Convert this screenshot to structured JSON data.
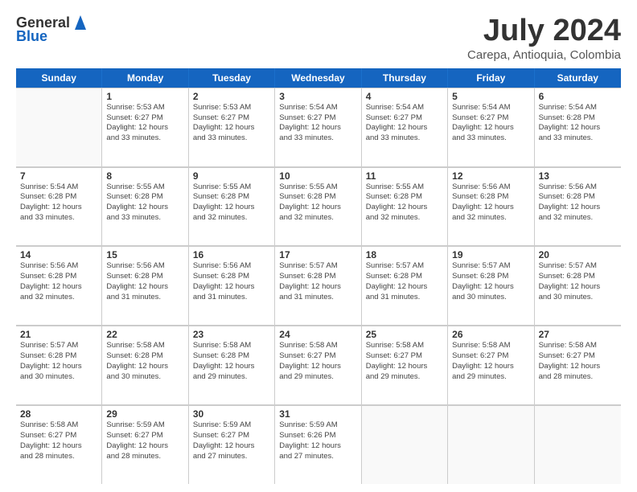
{
  "logo": {
    "text1": "General",
    "text2": "Blue"
  },
  "header": {
    "month": "July 2024",
    "location": "Carepa, Antioquia, Colombia"
  },
  "weekdays": [
    "Sunday",
    "Monday",
    "Tuesday",
    "Wednesday",
    "Thursday",
    "Friday",
    "Saturday"
  ],
  "rows": [
    [
      {
        "day": "",
        "info": ""
      },
      {
        "day": "1",
        "info": "Sunrise: 5:53 AM\nSunset: 6:27 PM\nDaylight: 12 hours\nand 33 minutes."
      },
      {
        "day": "2",
        "info": "Sunrise: 5:53 AM\nSunset: 6:27 PM\nDaylight: 12 hours\nand 33 minutes."
      },
      {
        "day": "3",
        "info": "Sunrise: 5:54 AM\nSunset: 6:27 PM\nDaylight: 12 hours\nand 33 minutes."
      },
      {
        "day": "4",
        "info": "Sunrise: 5:54 AM\nSunset: 6:27 PM\nDaylight: 12 hours\nand 33 minutes."
      },
      {
        "day": "5",
        "info": "Sunrise: 5:54 AM\nSunset: 6:27 PM\nDaylight: 12 hours\nand 33 minutes."
      },
      {
        "day": "6",
        "info": "Sunrise: 5:54 AM\nSunset: 6:28 PM\nDaylight: 12 hours\nand 33 minutes."
      }
    ],
    [
      {
        "day": "7",
        "info": "Sunrise: 5:54 AM\nSunset: 6:28 PM\nDaylight: 12 hours\nand 33 minutes."
      },
      {
        "day": "8",
        "info": "Sunrise: 5:55 AM\nSunset: 6:28 PM\nDaylight: 12 hours\nand 33 minutes."
      },
      {
        "day": "9",
        "info": "Sunrise: 5:55 AM\nSunset: 6:28 PM\nDaylight: 12 hours\nand 32 minutes."
      },
      {
        "day": "10",
        "info": "Sunrise: 5:55 AM\nSunset: 6:28 PM\nDaylight: 12 hours\nand 32 minutes."
      },
      {
        "day": "11",
        "info": "Sunrise: 5:55 AM\nSunset: 6:28 PM\nDaylight: 12 hours\nand 32 minutes."
      },
      {
        "day": "12",
        "info": "Sunrise: 5:56 AM\nSunset: 6:28 PM\nDaylight: 12 hours\nand 32 minutes."
      },
      {
        "day": "13",
        "info": "Sunrise: 5:56 AM\nSunset: 6:28 PM\nDaylight: 12 hours\nand 32 minutes."
      }
    ],
    [
      {
        "day": "14",
        "info": "Sunrise: 5:56 AM\nSunset: 6:28 PM\nDaylight: 12 hours\nand 32 minutes."
      },
      {
        "day": "15",
        "info": "Sunrise: 5:56 AM\nSunset: 6:28 PM\nDaylight: 12 hours\nand 31 minutes."
      },
      {
        "day": "16",
        "info": "Sunrise: 5:56 AM\nSunset: 6:28 PM\nDaylight: 12 hours\nand 31 minutes."
      },
      {
        "day": "17",
        "info": "Sunrise: 5:57 AM\nSunset: 6:28 PM\nDaylight: 12 hours\nand 31 minutes."
      },
      {
        "day": "18",
        "info": "Sunrise: 5:57 AM\nSunset: 6:28 PM\nDaylight: 12 hours\nand 31 minutes."
      },
      {
        "day": "19",
        "info": "Sunrise: 5:57 AM\nSunset: 6:28 PM\nDaylight: 12 hours\nand 30 minutes."
      },
      {
        "day": "20",
        "info": "Sunrise: 5:57 AM\nSunset: 6:28 PM\nDaylight: 12 hours\nand 30 minutes."
      }
    ],
    [
      {
        "day": "21",
        "info": "Sunrise: 5:57 AM\nSunset: 6:28 PM\nDaylight: 12 hours\nand 30 minutes."
      },
      {
        "day": "22",
        "info": "Sunrise: 5:58 AM\nSunset: 6:28 PM\nDaylight: 12 hours\nand 30 minutes."
      },
      {
        "day": "23",
        "info": "Sunrise: 5:58 AM\nSunset: 6:28 PM\nDaylight: 12 hours\nand 29 minutes."
      },
      {
        "day": "24",
        "info": "Sunrise: 5:58 AM\nSunset: 6:27 PM\nDaylight: 12 hours\nand 29 minutes."
      },
      {
        "day": "25",
        "info": "Sunrise: 5:58 AM\nSunset: 6:27 PM\nDaylight: 12 hours\nand 29 minutes."
      },
      {
        "day": "26",
        "info": "Sunrise: 5:58 AM\nSunset: 6:27 PM\nDaylight: 12 hours\nand 29 minutes."
      },
      {
        "day": "27",
        "info": "Sunrise: 5:58 AM\nSunset: 6:27 PM\nDaylight: 12 hours\nand 28 minutes."
      }
    ],
    [
      {
        "day": "28",
        "info": "Sunrise: 5:58 AM\nSunset: 6:27 PM\nDaylight: 12 hours\nand 28 minutes."
      },
      {
        "day": "29",
        "info": "Sunrise: 5:59 AM\nSunset: 6:27 PM\nDaylight: 12 hours\nand 28 minutes."
      },
      {
        "day": "30",
        "info": "Sunrise: 5:59 AM\nSunset: 6:27 PM\nDaylight: 12 hours\nand 27 minutes."
      },
      {
        "day": "31",
        "info": "Sunrise: 5:59 AM\nSunset: 6:26 PM\nDaylight: 12 hours\nand 27 minutes."
      },
      {
        "day": "",
        "info": ""
      },
      {
        "day": "",
        "info": ""
      },
      {
        "day": "",
        "info": ""
      }
    ]
  ]
}
